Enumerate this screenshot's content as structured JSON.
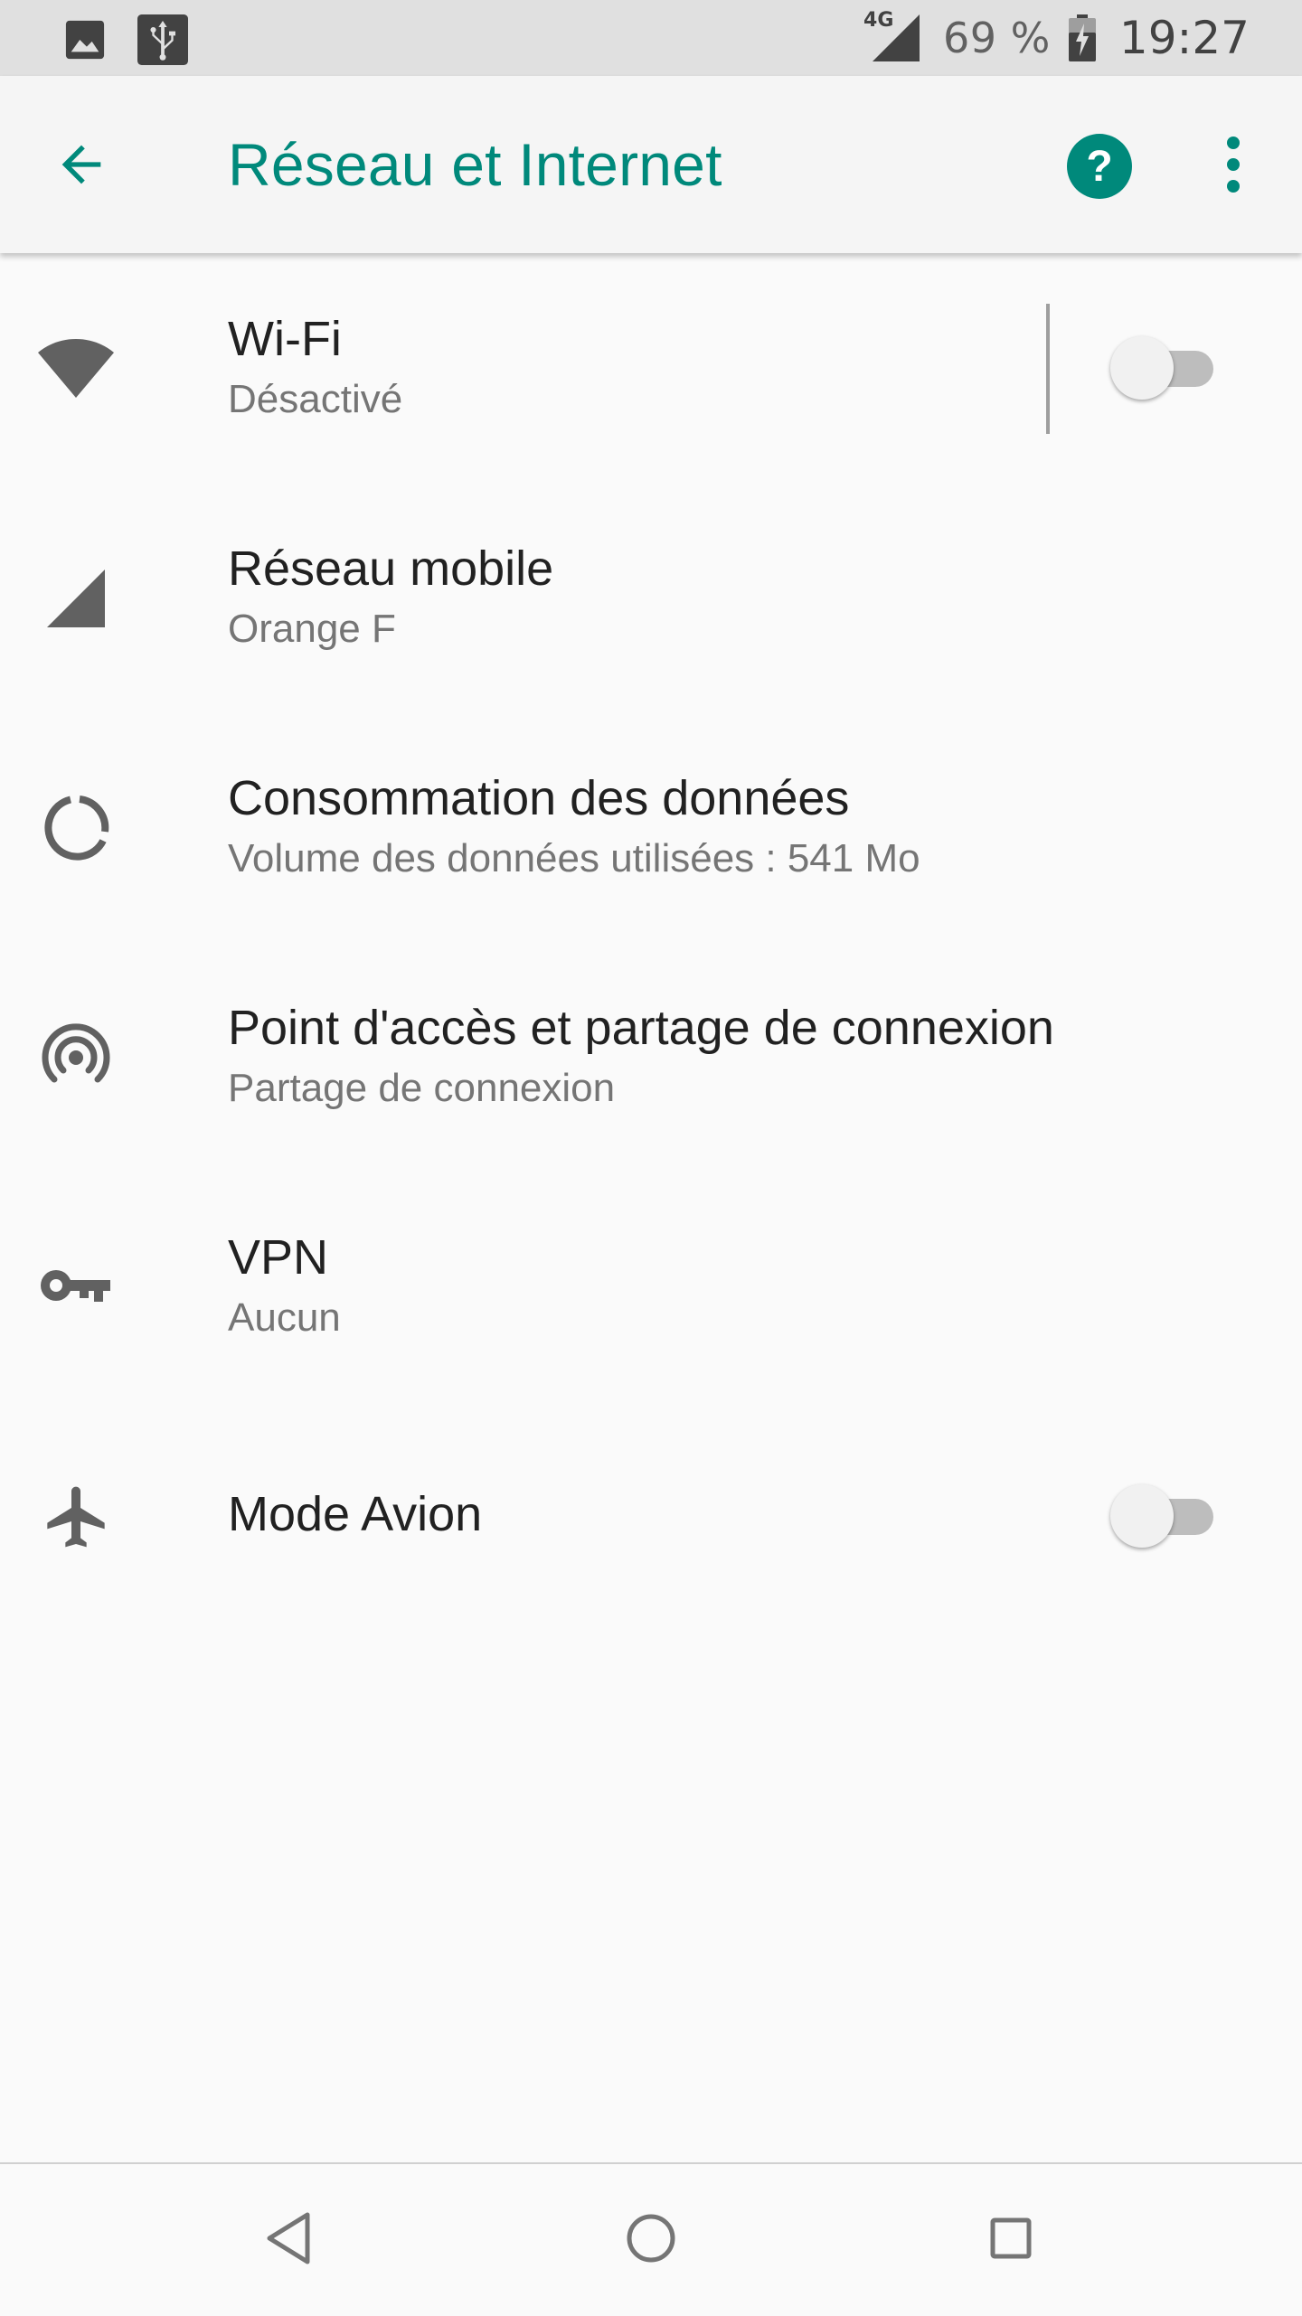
{
  "status_bar": {
    "left_icons": [
      "image-icon",
      "usb-icon"
    ],
    "network_type": "4G",
    "battery_percent": "69 %",
    "time": "19:27"
  },
  "app_bar": {
    "title": "Réseau et Internet",
    "back_icon": "arrow-back-icon",
    "help_icon": "help-icon",
    "more_icon": "more-vert-icon",
    "accent_color": "#00897b"
  },
  "settings": {
    "items": [
      {
        "icon": "wifi-icon",
        "title": "Wi-Fi",
        "subtitle": "Désactivé",
        "toggle": "off"
      },
      {
        "icon": "signal-icon",
        "title": "Réseau mobile",
        "subtitle": "Orange F"
      },
      {
        "icon": "data-usage-icon",
        "title": "Consommation des données",
        "subtitle": "Volume des données utilisées : 541 Mo"
      },
      {
        "icon": "hotspot-icon",
        "title": "Point d'accès et partage de connexion",
        "subtitle": "Partage de connexion"
      },
      {
        "icon": "vpn-key-icon",
        "title": "VPN",
        "subtitle": "Aucun"
      },
      {
        "icon": "airplane-icon",
        "title": "Mode Avion",
        "toggle": "off"
      }
    ]
  },
  "nav_bar": {
    "buttons": [
      "back-triangle-icon",
      "home-circle-icon",
      "recents-square-icon"
    ]
  }
}
